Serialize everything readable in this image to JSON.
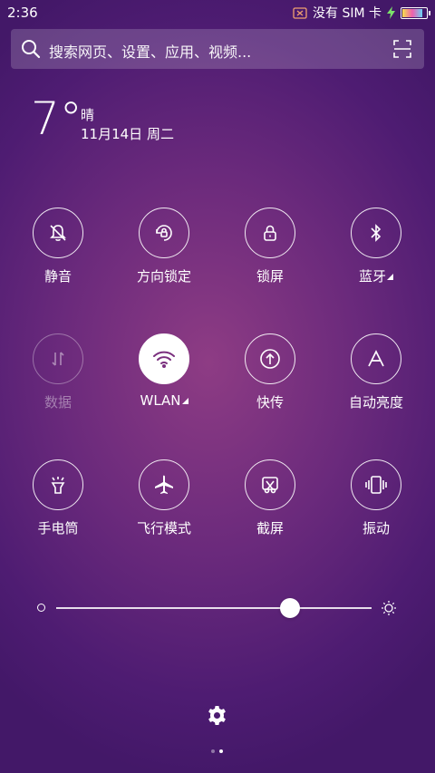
{
  "status_bar": {
    "time": "2:36",
    "sim_status": "没有 SIM 卡",
    "battery_icon": "battery-charging-icon"
  },
  "search": {
    "placeholder": "搜索网页、设置、应用、视频..."
  },
  "weather": {
    "temperature": "7°",
    "condition": "晴",
    "date": "11月14日 周二"
  },
  "toggles": [
    {
      "label": "静音",
      "icon": "mute-bell-icon",
      "state": "off"
    },
    {
      "label": "方向锁定",
      "icon": "rotation-lock-icon",
      "state": "off"
    },
    {
      "label": "锁屏",
      "icon": "lock-icon",
      "state": "off"
    },
    {
      "label": "蓝牙",
      "icon": "bluetooth-icon",
      "state": "off"
    },
    {
      "label": "数据",
      "icon": "mobile-data-icon",
      "state": "disabled"
    },
    {
      "label": "WLAN",
      "icon": "wifi-icon",
      "state": "on"
    },
    {
      "label": "快传",
      "icon": "quick-transfer-icon",
      "state": "off"
    },
    {
      "label": "自动亮度",
      "icon": "auto-brightness-icon",
      "state": "off"
    },
    {
      "label": "手电筒",
      "icon": "flashlight-icon",
      "state": "off"
    },
    {
      "label": "飞行模式",
      "icon": "airplane-icon",
      "state": "off"
    },
    {
      "label": "截屏",
      "icon": "screenshot-icon",
      "state": "off"
    },
    {
      "label": "振动",
      "icon": "vibrate-icon",
      "state": "off"
    }
  ],
  "brightness": {
    "level": 0.74
  },
  "pager": {
    "pages": 2,
    "current": 2
  },
  "colors": {
    "accent": "#ffffff",
    "background": "#6b2a7c"
  }
}
